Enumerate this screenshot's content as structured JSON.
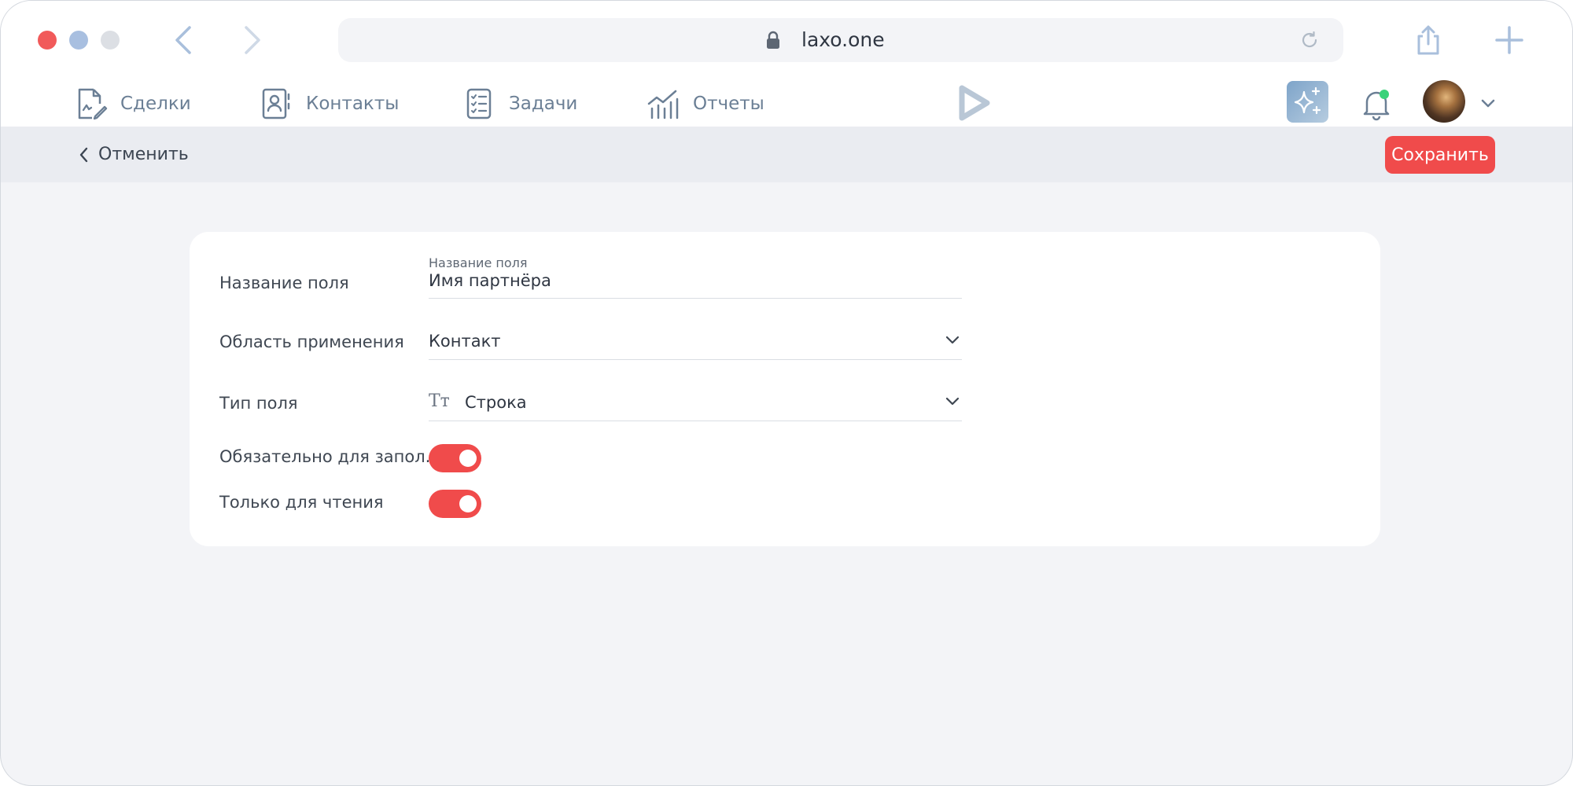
{
  "browser": {
    "url": "laxo.one",
    "traffic_lights": [
      "#f15a5a",
      "#a8bfe0",
      "#dcdfe4"
    ]
  },
  "nav": {
    "items": [
      {
        "label": "Сделки",
        "icon": "deals-document-icon"
      },
      {
        "label": "Контакты",
        "icon": "contacts-book-icon"
      },
      {
        "label": "Задачи",
        "icon": "tasks-checklist-icon"
      },
      {
        "label": "Отчеты",
        "icon": "reports-chart-icon"
      }
    ],
    "notification_dot_color": "#3ad27a"
  },
  "actions": {
    "cancel_label": "Отменить",
    "save_label": "Сохранить"
  },
  "form": {
    "name": {
      "label": "Название поля",
      "floating_label": "Название поля",
      "value": "Имя партнёра"
    },
    "scope": {
      "label": "Область применения",
      "value": "Контакт"
    },
    "type": {
      "label": "Тип поля",
      "icon_text": "Tт",
      "value": "Строка"
    },
    "required": {
      "label": "Обязательно для запол...",
      "on": true
    },
    "readonly": {
      "label": "Только для чтения",
      "on": true
    }
  },
  "colors": {
    "accent": "#f04b4b",
    "nav_text": "#6b7f95",
    "page_bg": "#f3f4f7"
  }
}
